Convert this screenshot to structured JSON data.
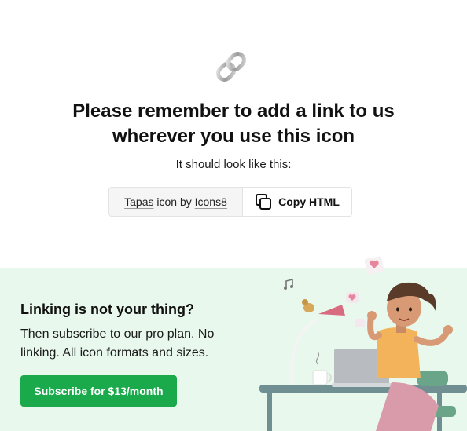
{
  "header": {
    "icon": "chain-link-icon",
    "headline_line1": "Please remember to add a link to us",
    "headline_line2": "wherever you use this icon",
    "subline": "It should look like this:"
  },
  "attribution": {
    "icon_name": "Tapas",
    "middle": " icon by ",
    "author": "Icons8",
    "copy_label": "Copy HTML",
    "copy_icon": "copy-icon"
  },
  "promo": {
    "title": "Linking is not your thing?",
    "text": "Then subscribe to our pro plan. No linking. All icon formats and sizes.",
    "button_label": "Subscribe for $13/month",
    "button_color": "#1aaa4b",
    "background": "#e8f8ec",
    "illustration": "woman-working-at-laptop-illustration"
  }
}
